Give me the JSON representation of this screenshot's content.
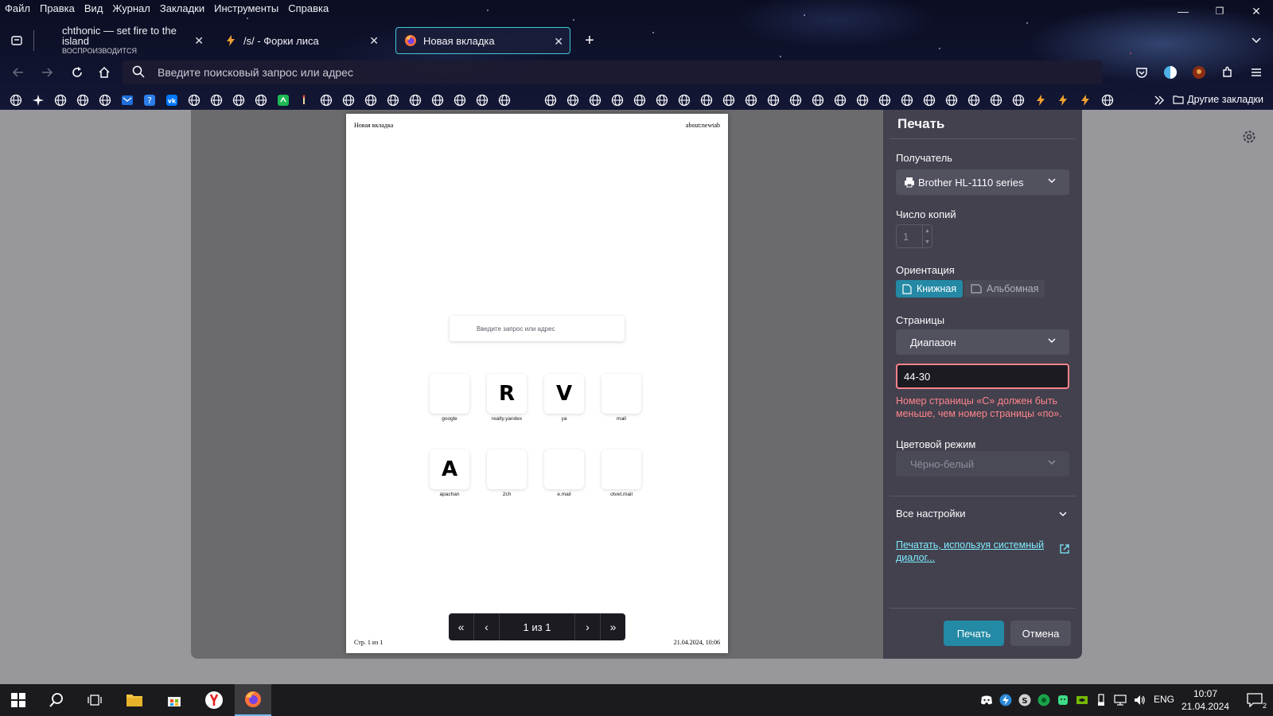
{
  "menubar": {
    "items": [
      "Файл",
      "Правка",
      "Вид",
      "Журнал",
      "Закладки",
      "Инструменты",
      "Справка"
    ]
  },
  "tabs": [
    {
      "title": "chthonic — set fire to the island",
      "subtitle": "ВОСПРОИЗВОДИТСЯ",
      "icon": "tab-list-icon"
    },
    {
      "title": "/s/ - Форки лиса",
      "icon": "lightning-icon"
    },
    {
      "title": "Новая вкладка",
      "icon": "firefox-icon",
      "active": true
    }
  ],
  "urlbar": {
    "placeholder": "Введите поисковый запрос или адрес"
  },
  "bookmarks": {
    "other_label": "Другие закладки"
  },
  "preview": {
    "header_left": "Новая вкладка",
    "header_right": "about:newtab",
    "footer_left": "Стр. 1 из 1",
    "footer_right": "21.04.2024, 10:06",
    "search_placeholder": "Введите запрос или адрес",
    "tiles": [
      {
        "label": "google",
        "glyph": ""
      },
      {
        "label": "realty.yandex",
        "glyph": "R"
      },
      {
        "label": "ya",
        "glyph": "V"
      },
      {
        "label": "mail",
        "glyph": ""
      },
      {
        "label": "apachan",
        "glyph": "A"
      },
      {
        "label": "2ch",
        "glyph": ""
      },
      {
        "label": "e.mail",
        "glyph": ""
      },
      {
        "label": "otvet.mail",
        "glyph": ""
      }
    ],
    "pager": {
      "info": "1 из 1"
    }
  },
  "print_panel": {
    "title": "Печать",
    "destination_label": "Получатель",
    "destination_value": "Brother HL-1110 series",
    "copies_label": "Число копий",
    "copies_value": "1",
    "orientation_label": "Ориентация",
    "orientation_portrait": "Книжная",
    "orientation_landscape": "Альбомная",
    "pages_label": "Страницы",
    "pages_value": "Диапазон",
    "range_value": "44-30",
    "range_error": "Номер страницы «С» должен быть меньше, чем номер страницы «по».",
    "color_label": "Цветовой режим",
    "color_value": "Чёрно-белый",
    "more_settings": "Все настройки",
    "system_dialog_link": "Печатать, используя системный диалог...",
    "print_button": "Печать",
    "cancel_button": "Отмена"
  },
  "taskbar": {
    "time": "10:07",
    "date": "21.04.2024",
    "lang": "ENG",
    "notifications": "2"
  },
  "colors": {
    "accent": "#2389a4",
    "error": "#ff848b",
    "link": "#80ebff",
    "panel": "#42414d"
  }
}
